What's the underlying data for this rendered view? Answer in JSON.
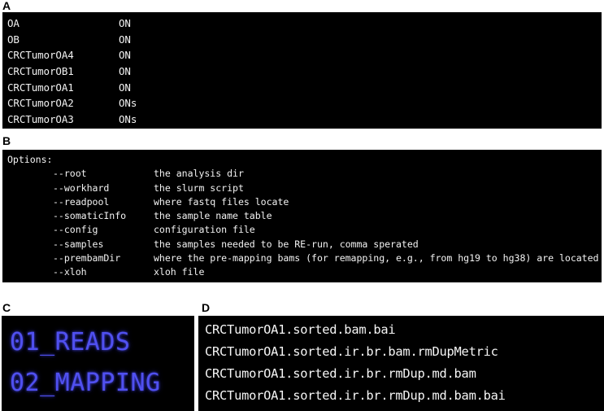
{
  "figure": {
    "background_color": "#ffffff",
    "terminal_background": "#000000",
    "terminal_text_color": "#f4f4f4",
    "accent_blue": "#5050f0"
  },
  "panels": {
    "a": {
      "letter": "A",
      "rows": [
        {
          "name": "OA",
          "value": "ON"
        },
        {
          "name": "OB",
          "value": "ON"
        },
        {
          "name": "CRCTumorOA4",
          "value": "ON"
        },
        {
          "name": "CRCTumorOB1",
          "value": "ON"
        },
        {
          "name": "CRCTumorOA1",
          "value": "ON"
        },
        {
          "name": "CRCTumorOA2",
          "value": "ONs"
        },
        {
          "name": "CRCTumorOA3",
          "value": "ONs"
        }
      ]
    },
    "b": {
      "letter": "B",
      "heading": "Options:",
      "options": [
        {
          "flag": "--root",
          "description": "the analysis dir"
        },
        {
          "flag": "--workhard",
          "description": "the slurm script"
        },
        {
          "flag": "--readpool",
          "description": "where fastq files locate"
        },
        {
          "flag": "--somaticInfo",
          "description": "the sample name table"
        },
        {
          "flag": "--config",
          "description": "configuration file"
        },
        {
          "flag": "--samples",
          "description": "the samples needed to be RE-run, comma sperated"
        },
        {
          "flag": "--prembamDir",
          "description": "where the pre-mapping bams (for remapping, e.g., from hg19 to hg38) are located"
        },
        {
          "flag": "--xloh",
          "description": "xloh file"
        }
      ]
    },
    "c": {
      "letter": "C",
      "directories": [
        "01_READS",
        "02_MAPPING"
      ]
    },
    "d": {
      "letter": "D",
      "files": [
        "CRCTumorOA1.sorted.bam.bai",
        "CRCTumorOA1.sorted.ir.br.bam.rmDupMetric",
        "CRCTumorOA1.sorted.ir.br.rmDup.md.bam",
        "CRCTumorOA1.sorted.ir.br.rmDup.md.bam.bai"
      ]
    }
  }
}
